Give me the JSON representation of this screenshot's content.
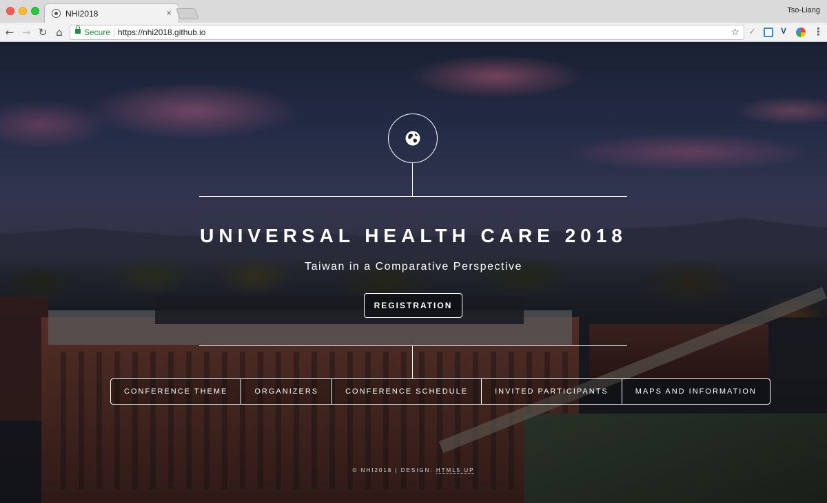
{
  "browser": {
    "tab_title": "NHI2018",
    "tab_close": "×",
    "profile_name": "Tso-Liang",
    "secure_label": "Secure",
    "url": "https://nhi2018.github.io",
    "star": "☆",
    "icons": [
      "back-icon",
      "forward-icon",
      "reload-icon",
      "home-icon",
      "lock-icon",
      "star-icon",
      "check-icon",
      "s-extension-icon",
      "v-extension-icon",
      "color-extension-icon",
      "menu-icon"
    ]
  },
  "page": {
    "title": "UNIVERSAL HEALTH CARE 2018",
    "subtitle": "Taiwan in a Comparative Perspective",
    "registration_label": "REGISTRATION",
    "nav": [
      {
        "label": "CONFERENCE THEME"
      },
      {
        "label": "ORGANIZERS"
      },
      {
        "label": "CONFERENCE SCHEDULE"
      },
      {
        "label": "INVITED PARTICIPANTS"
      },
      {
        "label": "MAPS AND INFORMATION"
      }
    ],
    "footer_text": "© NHI2018 | DESIGN:",
    "footer_link": "HTML5 UP",
    "logo_icon": "globe-icon"
  }
}
